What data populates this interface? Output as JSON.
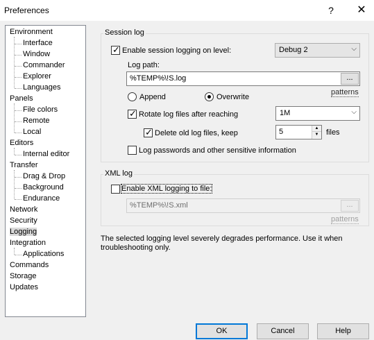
{
  "window": {
    "title": "Preferences",
    "help_glyph": "?",
    "close_glyph": "✕"
  },
  "tree": {
    "items": [
      {
        "label": "Environment",
        "level": 0
      },
      {
        "label": "Interface",
        "level": 1
      },
      {
        "label": "Window",
        "level": 1
      },
      {
        "label": "Commander",
        "level": 1
      },
      {
        "label": "Explorer",
        "level": 1
      },
      {
        "label": "Languages",
        "level": 1
      },
      {
        "label": "Panels",
        "level": 0
      },
      {
        "label": "File colors",
        "level": 1
      },
      {
        "label": "Remote",
        "level": 1
      },
      {
        "label": "Local",
        "level": 1
      },
      {
        "label": "Editors",
        "level": 0
      },
      {
        "label": "Internal editor",
        "level": 1
      },
      {
        "label": "Transfer",
        "level": 0
      },
      {
        "label": "Drag & Drop",
        "level": 1
      },
      {
        "label": "Background",
        "level": 1
      },
      {
        "label": "Endurance",
        "level": 1
      },
      {
        "label": "Network",
        "level": 0
      },
      {
        "label": "Security",
        "level": 0
      },
      {
        "label": "Logging",
        "level": 0,
        "selected": true
      },
      {
        "label": "Integration",
        "level": 0
      },
      {
        "label": "Applications",
        "level": 1
      },
      {
        "label": "Commands",
        "level": 0
      },
      {
        "label": "Storage",
        "level": 0
      },
      {
        "label": "Updates",
        "level": 0
      }
    ]
  },
  "session_log": {
    "group_label": "Session log",
    "enable_label": "Enable session logging on level:",
    "enable_checked": true,
    "level_value": "Debug 2",
    "log_path_label": "Log path:",
    "log_path_value": "%TEMP%\\!S.log",
    "browse_label": "...",
    "patterns_label": "patterns",
    "append_label": "Append",
    "overwrite_label": "Overwrite",
    "overwrite_selected": true,
    "rotate_label": "Rotate log files after reaching",
    "rotate_checked": true,
    "rotate_value": "1M",
    "delete_old_label": "Delete old log files, keep",
    "delete_old_checked": true,
    "keep_value": "5",
    "files_label": "files",
    "passwords_label": "Log passwords and other sensitive information",
    "passwords_checked": false
  },
  "xml_log": {
    "group_label": "XML log",
    "enable_label": "Enable XML logging to file:",
    "enable_checked": false,
    "path_value": "%TEMP%\\!S.xml",
    "browse_label": "...",
    "patterns_label": "patterns"
  },
  "warning_text": "The selected logging level severely degrades performance. Use it when troubleshooting only.",
  "buttons": {
    "ok": "OK",
    "cancel": "Cancel",
    "help": "Help"
  },
  "glyphs": {
    "check": "✓",
    "dropdown": "⌵",
    "up": "▲",
    "down": "▼"
  }
}
